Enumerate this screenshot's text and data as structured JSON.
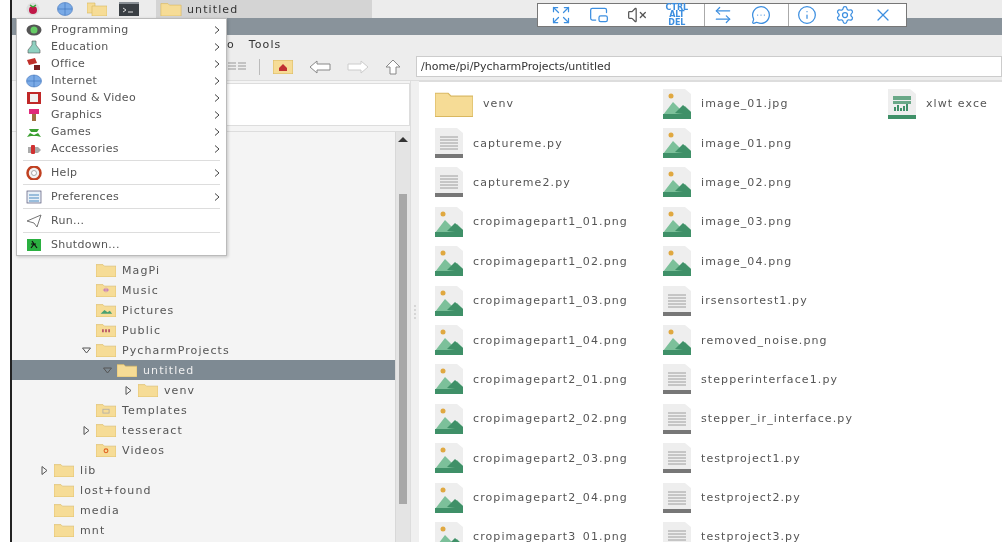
{
  "taskbar": {
    "launchers": [
      {
        "kind": "raspberry"
      },
      {
        "kind": "globe"
      },
      {
        "kind": "folders"
      },
      {
        "kind": "terminal"
      }
    ],
    "task": {
      "label": "untitled",
      "selected": true
    }
  },
  "remote_toolbar": {
    "buttons": [
      {
        "kind": "fullscreen"
      },
      {
        "kind": "window"
      },
      {
        "kind": "mute"
      },
      {
        "kind": "keys",
        "label": "CTRL\nALT\nDEL"
      },
      {
        "kind": "transfer",
        "group_start": true
      },
      {
        "kind": "chat"
      },
      {
        "kind": "info",
        "group_start": true
      },
      {
        "kind": "settings"
      },
      {
        "kind": "close"
      }
    ]
  },
  "menubar": {
    "items": [
      "o",
      "Tools"
    ]
  },
  "toolbar": {
    "path": "/home/pi/PycharmProjects/untitled"
  },
  "app_menu": {
    "entries": [
      {
        "kind": "item",
        "label": "Programming",
        "submenu": true
      },
      {
        "kind": "item",
        "label": "Education",
        "submenu": true
      },
      {
        "kind": "item",
        "label": "Office",
        "submenu": true
      },
      {
        "kind": "item",
        "label": "Internet",
        "submenu": true
      },
      {
        "kind": "item",
        "label": "Sound & Video",
        "submenu": true
      },
      {
        "kind": "item",
        "label": "Graphics",
        "submenu": true
      },
      {
        "kind": "item",
        "label": "Games",
        "submenu": true
      },
      {
        "kind": "item",
        "label": "Accessories",
        "submenu": true
      },
      {
        "kind": "separator"
      },
      {
        "kind": "item",
        "label": "Help",
        "submenu": true
      },
      {
        "kind": "separator"
      },
      {
        "kind": "item",
        "label": "Preferences",
        "submenu": true
      },
      {
        "kind": "separator"
      },
      {
        "kind": "item",
        "label": "Run...",
        "submenu": false
      },
      {
        "kind": "separator"
      },
      {
        "kind": "item",
        "label": "Shutdown...",
        "submenu": false
      }
    ]
  },
  "tree": [
    {
      "children": [
        {
          "children": [
            {
              "name": "MagPi",
              "selected": false
            },
            {
              "name": "Music",
              "kind": "music",
              "selected": false
            },
            {
              "name": "Pictures",
              "kind": "pictures",
              "selected": false
            },
            {
              "name": "Public",
              "kind": "public",
              "selected": false
            },
            {
              "name": "PycharmProjects",
              "expanded": true,
              "selected": false,
              "children": [
                {
                  "name": "untitled",
                  "expanded": true,
                  "selected": true,
                  "children": [
                    {
                      "name": "venv",
                      "expanded": false,
                      "selected": false
                    }
                  ]
                }
              ]
            },
            {
              "name": "Templates",
              "kind": "templates",
              "selected": false
            },
            {
              "name": "tesseract",
              "expanded": false,
              "selected": false
            },
            {
              "name": "Videos",
              "kind": "videos",
              "selected": false
            }
          ]
        }
      ]
    },
    {
      "name": "lib",
      "expanded": false,
      "selected": false
    },
    {
      "name": "lost+found",
      "selected": false
    },
    {
      "name": "media",
      "selected": false
    },
    {
      "name": "mnt",
      "selected": false
    }
  ],
  "files": [
    {
      "name": "venv",
      "kind": "folder"
    },
    {
      "name": "captureme.py",
      "kind": "text"
    },
    {
      "name": "captureme2.py",
      "kind": "text"
    },
    {
      "name": "cropimagepart1_01.png",
      "kind": "image"
    },
    {
      "name": "cropimagepart1_02.png",
      "kind": "image"
    },
    {
      "name": "cropimagepart1_03.png",
      "kind": "image"
    },
    {
      "name": "cropimagepart1_04.png",
      "kind": "image"
    },
    {
      "name": "cropimagepart2_01.png",
      "kind": "image"
    },
    {
      "name": "cropimagepart2_02.png",
      "kind": "image"
    },
    {
      "name": "cropimagepart2_03.png",
      "kind": "image"
    },
    {
      "name": "cropimagepart2_04.png",
      "kind": "image"
    },
    {
      "name": "cropimagepart3_01.png",
      "kind": "image"
    },
    {
      "name": "image_01.jpg",
      "kind": "image"
    },
    {
      "name": "image_01.png",
      "kind": "image"
    },
    {
      "name": "image_02.png",
      "kind": "image"
    },
    {
      "name": "image_03.png",
      "kind": "image"
    },
    {
      "name": "image_04.png",
      "kind": "image"
    },
    {
      "name": "irsensortest1.py",
      "kind": "text"
    },
    {
      "name": "removed_noise.png",
      "kind": "image"
    },
    {
      "name": "stepperinterface1.py",
      "kind": "text"
    },
    {
      "name": "stepper_ir_interface.py",
      "kind": "text"
    },
    {
      "name": "testproject1.py",
      "kind": "text"
    },
    {
      "name": "testproject2.py",
      "kind": "text"
    },
    {
      "name": "testproject3.py",
      "kind": "text"
    },
    {
      "name": "xlwt exce",
      "kind": "spreadsheet"
    }
  ]
}
